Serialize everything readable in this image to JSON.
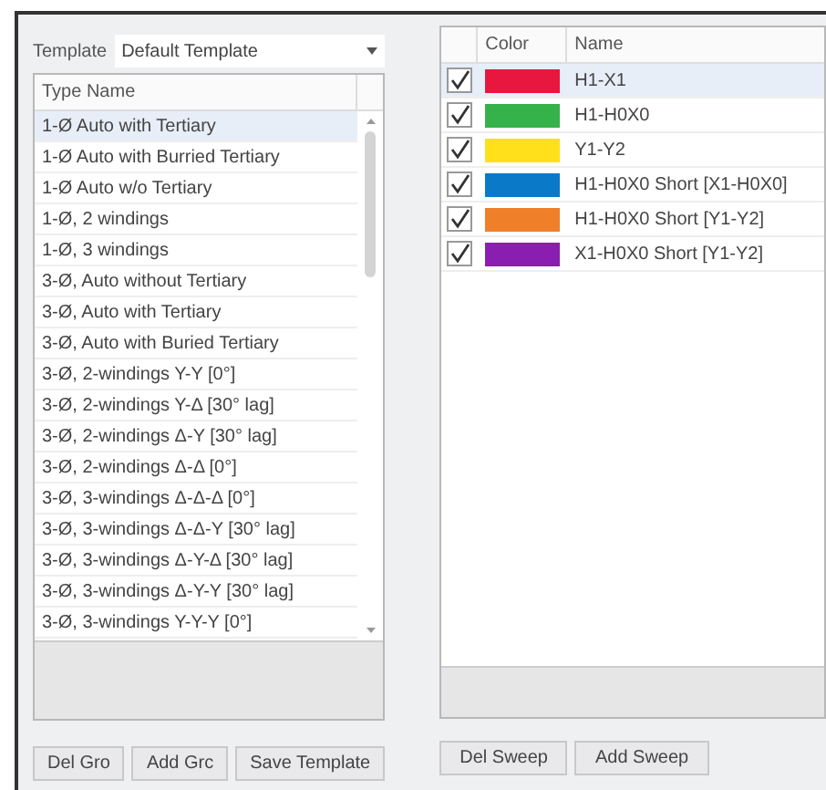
{
  "template": {
    "label": "Template",
    "value": "Default Template"
  },
  "types": {
    "column": "Type Name",
    "rows": [
      {
        "name": "1-Ø Auto with Tertiary",
        "selected": true
      },
      {
        "name": "1-Ø Auto with Burried Tertiary",
        "selected": false
      },
      {
        "name": "1-Ø Auto w/o Tertiary",
        "selected": false
      },
      {
        "name": "1-Ø, 2 windings",
        "selected": false
      },
      {
        "name": "1-Ø, 3 windings",
        "selected": false
      },
      {
        "name": "3-Ø, Auto without Tertiary",
        "selected": false
      },
      {
        "name": "3-Ø, Auto with Tertiary",
        "selected": false
      },
      {
        "name": "3-Ø, Auto with Buried Tertiary",
        "selected": false
      },
      {
        "name": "3-Ø, 2-windings Y-Y [0°]",
        "selected": false
      },
      {
        "name": "3-Ø, 2-windings Y-Δ [30° lag]",
        "selected": false
      },
      {
        "name": "3-Ø, 2-windings Δ-Y [30° lag]",
        "selected": false
      },
      {
        "name": "3-Ø, 2-windings Δ-Δ [0°]",
        "selected": false
      },
      {
        "name": "3-Ø, 3-windings Δ-Δ-Δ [0°]",
        "selected": false
      },
      {
        "name": "3-Ø, 3-windings Δ-Δ-Y [30° lag]",
        "selected": false
      },
      {
        "name": "3-Ø, 3-windings Δ-Y-Δ [30° lag]",
        "selected": false
      },
      {
        "name": "3-Ø, 3-windings Δ-Y-Y [30° lag]",
        "selected": false
      },
      {
        "name": "3-Ø, 3-windings Y-Y-Y [0°]",
        "selected": false
      }
    ]
  },
  "left_buttons": [
    "Del Gro",
    "Add Grc",
    "Save Template"
  ],
  "sweeps": {
    "columns": [
      "Color",
      "Name"
    ],
    "rows": [
      {
        "checked": true,
        "color": "#e8173f",
        "name": "H1-X1",
        "selected": true
      },
      {
        "checked": true,
        "color": "#35b24a",
        "name": "H1-H0X0",
        "selected": false
      },
      {
        "checked": true,
        "color": "#ffe01a",
        "name": "Y1-Y2",
        "selected": false
      },
      {
        "checked": true,
        "color": "#0a7ac8",
        "name": "H1-H0X0 Short [X1-H0X0]",
        "selected": false
      },
      {
        "checked": true,
        "color": "#f07f2a",
        "name": "H1-H0X0 Short [Y1-Y2]",
        "selected": false
      },
      {
        "checked": true,
        "color": "#8a1eb0",
        "name": "X1-H0X0 Short [Y1-Y2]",
        "selected": false
      }
    ]
  },
  "right_buttons": [
    "Del Sweep",
    "Add Sweep"
  ]
}
